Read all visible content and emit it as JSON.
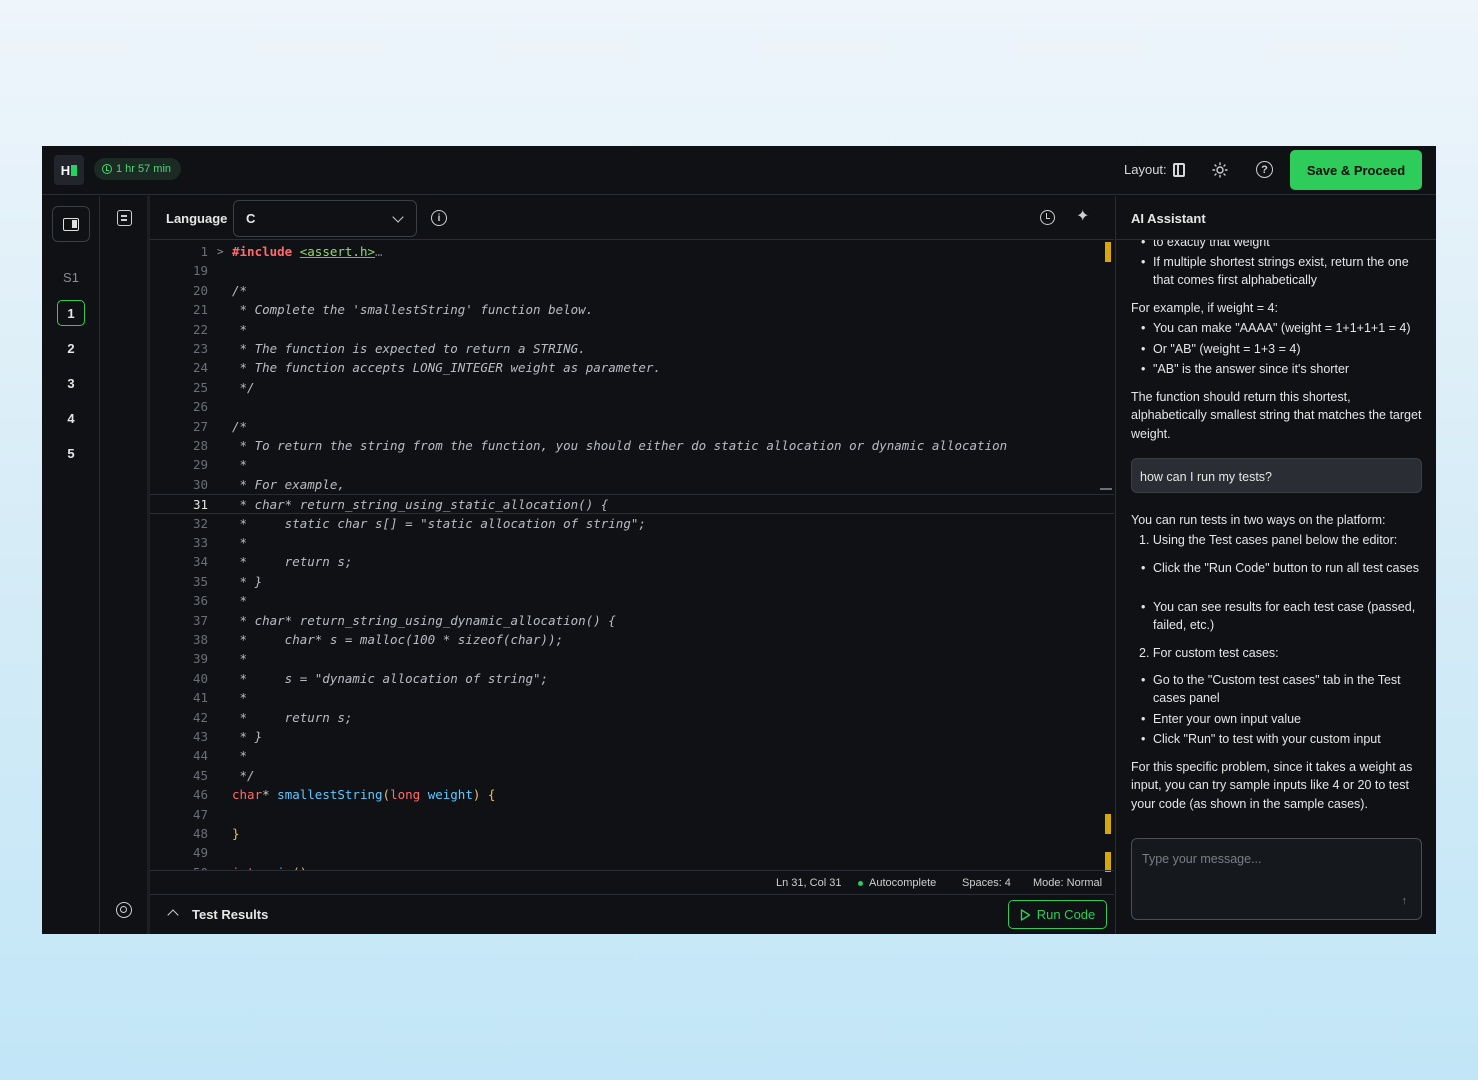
{
  "topbar": {
    "logo_text": "H",
    "timer": "1 hr 57 min",
    "layout_label": "Layout:",
    "save_label": "Save & Proceed"
  },
  "rail": {
    "section": "S1",
    "items": [
      "1",
      "2",
      "3",
      "4",
      "5"
    ],
    "active_item": "1"
  },
  "editor": {
    "language_label": "Language",
    "language_value": "C",
    "lines": [
      {
        "n": "1",
        "fold": ">",
        "text": "#include <assert.h>…",
        "kind": "include"
      },
      {
        "n": "19",
        "text": "",
        "kind": "plain"
      },
      {
        "n": "20",
        "text": "/*",
        "kind": "comment"
      },
      {
        "n": "21",
        "text": " * Complete the 'smallestString' function below.",
        "kind": "comment"
      },
      {
        "n": "22",
        "text": " *",
        "kind": "comment"
      },
      {
        "n": "23",
        "text": " * The function is expected to return a STRING.",
        "kind": "comment"
      },
      {
        "n": "24",
        "text": " * The function accepts LONG_INTEGER weight as parameter.",
        "kind": "comment"
      },
      {
        "n": "25",
        "text": " */",
        "kind": "comment"
      },
      {
        "n": "26",
        "text": "",
        "kind": "plain"
      },
      {
        "n": "27",
        "text": "/*",
        "kind": "comment"
      },
      {
        "n": "28",
        "text": " * To return the string from the function, you should either do static allocation or dynamic allocation",
        "kind": "comment"
      },
      {
        "n": "29",
        "text": " *",
        "kind": "comment"
      },
      {
        "n": "30",
        "text": " * For example,",
        "kind": "comment"
      },
      {
        "n": "31",
        "text": " * char* return_string_using_static_allocation() {",
        "kind": "comment",
        "current": true
      },
      {
        "n": "32",
        "text": " *     static char s[] = \"static allocation of string\";",
        "kind": "comment"
      },
      {
        "n": "33",
        "text": " *",
        "kind": "comment"
      },
      {
        "n": "34",
        "text": " *     return s;",
        "kind": "comment"
      },
      {
        "n": "35",
        "text": " * }",
        "kind": "comment"
      },
      {
        "n": "36",
        "text": " *",
        "kind": "comment"
      },
      {
        "n": "37",
        "text": " * char* return_string_using_dynamic_allocation() {",
        "kind": "comment"
      },
      {
        "n": "38",
        "text": " *     char* s = malloc(100 * sizeof(char));",
        "kind": "comment"
      },
      {
        "n": "39",
        "text": " *",
        "kind": "comment"
      },
      {
        "n": "40",
        "text": " *     s = \"dynamic allocation of string\";",
        "kind": "comment"
      },
      {
        "n": "41",
        "text": " *",
        "kind": "comment"
      },
      {
        "n": "42",
        "text": " *     return s;",
        "kind": "comment"
      },
      {
        "n": "43",
        "text": " * }",
        "kind": "comment"
      },
      {
        "n": "44",
        "text": " *",
        "kind": "comment"
      },
      {
        "n": "45",
        "text": " */",
        "kind": "comment"
      },
      {
        "n": "46",
        "text": "char* smallestString(long weight) {",
        "kind": "signature"
      },
      {
        "n": "47",
        "text": "",
        "kind": "plain"
      },
      {
        "n": "48",
        "text": "}",
        "kind": "brace"
      },
      {
        "n": "49",
        "text": "",
        "kind": "plain"
      },
      {
        "n": "50",
        "fold": ">",
        "text": "int main()…",
        "kind": "main"
      }
    ],
    "status": {
      "position": "Ln 31, Col 31",
      "autocomplete": "Autocomplete",
      "spaces": "Spaces: 4",
      "mode": "Mode: Normal"
    },
    "results_label": "Test Results",
    "run_label": "Run Code",
    "colors": {
      "accent": "#2ecc5a",
      "scroll_marker": "#d6a80a"
    }
  },
  "assistant": {
    "title": "AI Assistant",
    "clipped_top": "to exactly that weight",
    "intro_bullet": "If multiple shortest strings exist, return the one that comes first alphabetically",
    "example_intro": "For example, if weight = 4:",
    "example_bullets": [
      "You can make \"AAAA\" (weight = 1+1+1+1 = 4)",
      "Or \"AB\" (weight = 1+3 = 4)",
      "\"AB\" is the answer since it's shorter"
    ],
    "summary": "The function should return this shortest, alphabetically smallest string that matches the target weight.",
    "user_message": "how can I run my tests?",
    "reply_intro": "You can run tests in two ways on the platform:",
    "step1": "1. Using the Test cases panel below the editor:",
    "step1_bullets": [
      "Click the \"Run Code\" button to run all test cases",
      "You can see results for each test case (passed, failed, etc.)"
    ],
    "step2": "2. For custom test cases:",
    "step2_bullets": [
      "Go to the \"Custom test cases\" tab in the Test cases panel",
      "Enter your own input value",
      "Click \"Run\" to test with your custom input"
    ],
    "closing": "For this specific problem, since it takes a weight as input, you can try sample inputs like 4 or 20 to test your code (as shown in the sample cases).",
    "input_placeholder": "Type your message..."
  }
}
